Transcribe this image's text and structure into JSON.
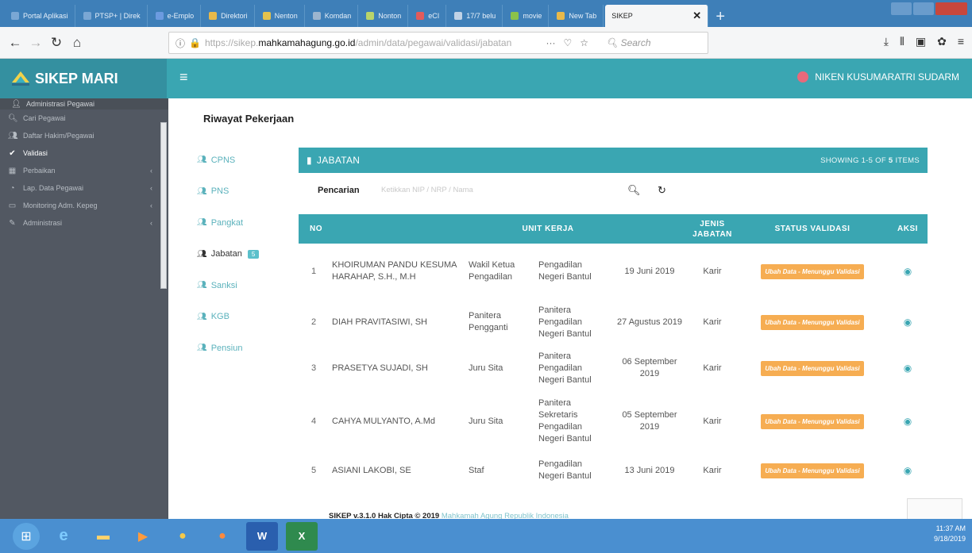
{
  "browser": {
    "tabs": [
      {
        "label": "Portal Aplikasi",
        "color": "#7aa7d4"
      },
      {
        "label": "PTSP+ | Direk",
        "color": "#7aa7d4"
      },
      {
        "label": "e-Emplo",
        "color": "#6c9be0"
      },
      {
        "label": "Direktori",
        "color": "#e8b94a"
      },
      {
        "label": "Nenton",
        "color": "#e3c24d"
      },
      {
        "label": "Komdan",
        "color": "#9cb5cf"
      },
      {
        "label": "Nonton",
        "color": "#b9d46a"
      },
      {
        "label": "eCI",
        "color": "#e25b5b"
      },
      {
        "label": "17/7 belu",
        "color": "#c0d2e6"
      },
      {
        "label": "movie",
        "color": "#8bc24a"
      },
      {
        "label": "New Tab",
        "color": "#e8b94a"
      }
    ],
    "active_tab": "SIKEP",
    "url": {
      "prefix": "https://sikep.",
      "domain": "mahkamahagung.go.id",
      "rest": "/admin/data/pegawai/validasi/jabatan"
    },
    "search_placeholder": "Search"
  },
  "app": {
    "brand": "SIKEP MARI",
    "user": "NIKEN KUSUMARATRI SUDARM"
  },
  "sidebar": {
    "items": [
      {
        "label": "Administrasi Pegawai",
        "icon": "user-icon",
        "type": "head"
      },
      {
        "label": "Cari Pegawai",
        "icon": "search-icon"
      },
      {
        "label": "Daftar Hakim/Pegawai",
        "icon": "users-icon"
      },
      {
        "label": "Validasi",
        "icon": "check-icon",
        "active": true
      },
      {
        "label": "Perbaikan",
        "icon": "calendar-icon",
        "chevron": true
      },
      {
        "label": "Lap. Data Pegawai",
        "icon": "chart-icon",
        "chevron": true
      },
      {
        "label": "Monitoring Adm. Kepeg",
        "icon": "monitor-icon",
        "chevron": true
      },
      {
        "label": "Administrasi",
        "icon": "edit-icon",
        "chevron": true
      }
    ]
  },
  "page": {
    "title": "Riwayat Pekerjaan",
    "subnav": [
      {
        "label": "CPNS"
      },
      {
        "label": "PNS"
      },
      {
        "label": "Pangkat"
      },
      {
        "label": "Jabatan",
        "badge": "5",
        "active": true
      },
      {
        "label": "Sanksi"
      },
      {
        "label": "KGB"
      },
      {
        "label": "Pensiun"
      }
    ]
  },
  "panel": {
    "title": "JABATAN",
    "showing_prefix": "SHOWING 1-5 OF",
    "showing_count": "5",
    "showing_suffix": "ITEMS",
    "search_label": "Pencarian",
    "search_placeholder": "Ketikkan NIP / NRP / Nama",
    "columns": {
      "no": "NO",
      "unit": "UNIT KERJA",
      "jenis": "JENIS JABATAN",
      "status": "STATUS VALIDASI",
      "aksi": "AKSI"
    },
    "rows": [
      {
        "no": "1",
        "nama": "KHOIRUMAN PANDU KESUMA HARAHAP, S.H., M.H",
        "jabatan": "Wakil Ketua Pengadilan",
        "unit": "Pengadilan Negeri Bantul",
        "tanggal": "19 Juni 2019",
        "jenis": "Karir",
        "status": "Ubah Data - Menunggu Validasi"
      },
      {
        "no": "2",
        "nama": "DIAH PRAVITASIWI, SH",
        "jabatan": "Panitera Pengganti",
        "unit": "Panitera Pengadilan Negeri Bantul",
        "tanggal": "27 Agustus 2019",
        "jenis": "Karir",
        "status": "Ubah Data - Menunggu Validasi"
      },
      {
        "no": "3",
        "nama": "PRASETYA SUJADI, SH",
        "jabatan": "Juru Sita",
        "unit": "Panitera Pengadilan Negeri Bantul",
        "tanggal": "06 September 2019",
        "jenis": "Karir",
        "status": "Ubah Data - Menunggu Validasi"
      },
      {
        "no": "4",
        "nama": "CAHYA MULYANTO, A.Md",
        "jabatan": "Juru Sita",
        "unit": "Panitera Sekretaris Pengadilan Negeri Bantul",
        "tanggal": "05 September 2019",
        "jenis": "Karir",
        "status": "Ubah Data - Menunggu Validasi"
      },
      {
        "no": "5",
        "nama": "ASIANI LAKOBI, SE",
        "jabatan": "Staf",
        "unit": "Pengadilan Negeri Bantul",
        "tanggal": "13 Juni 2019",
        "jenis": "Karir",
        "status": "Ubah Data - Menunggu Validasi"
      }
    ]
  },
  "footer": {
    "text": "SIKEP v.3.1.0 Hak Cipta © 2019",
    "link": "Mahkamah Agung Republik Indonesia"
  },
  "taskbar": {
    "time": "11:37 AM",
    "date": "9/18/2019"
  }
}
